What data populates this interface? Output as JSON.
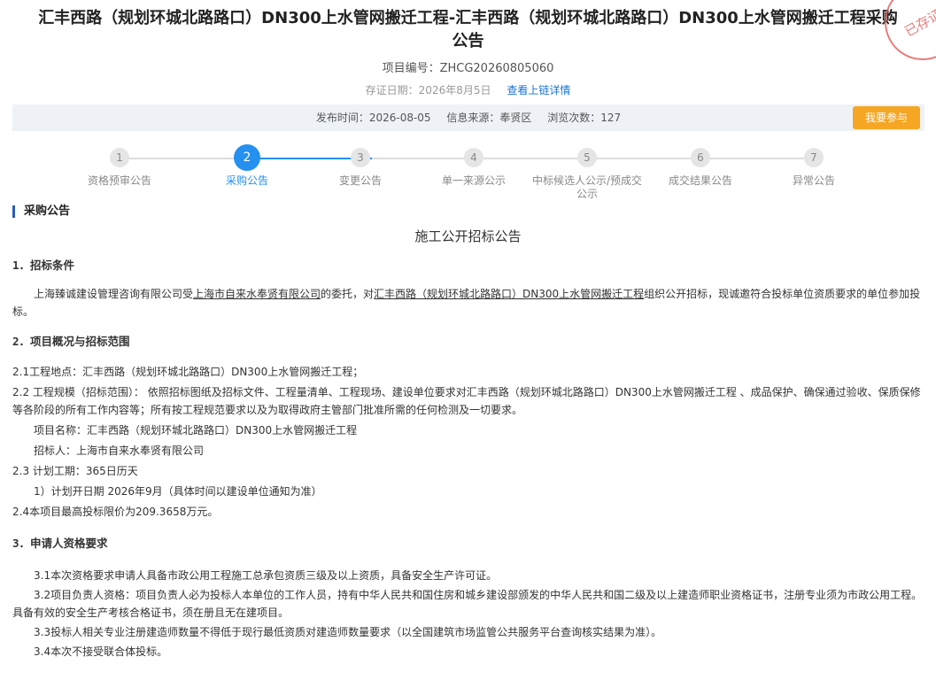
{
  "title": "汇丰西路（规划环城北路路口）DN300上水管网搬迁工程-汇丰西路（规划环城北路路口）DN300上水管网搬迁工程采购公告",
  "stamp_text": "已存证",
  "project_no": "项目编号：ZHCG20260805060",
  "deposit_date": "存证日期：2026年8月5日",
  "deposit_link": "查看上链详情",
  "info": {
    "publish_time": "发布时间：2026-08-05",
    "source": "信息来源：奉贤区",
    "views": "浏览次数：127",
    "join_button": "我要参与"
  },
  "steps": [
    {
      "num": "1",
      "label": "资格预审公告"
    },
    {
      "num": "2",
      "label": "采购公告"
    },
    {
      "num": "3",
      "label": "变更公告"
    },
    {
      "num": "4",
      "label": "单一来源公示"
    },
    {
      "num": "5",
      "label": "中标候选人公示/预成交公示"
    },
    {
      "num": "6",
      "label": "成交结果公告"
    },
    {
      "num": "7",
      "label": "异常公告"
    }
  ],
  "section_heading": "采购公告",
  "doc_title": "施工公开招标公告",
  "content": {
    "s1_head": "1．招标条件",
    "s1_p_a": "上海臻诚建设管理咨询有限公司受",
    "s1_p_b": "上海市自来水奉贤有限公司",
    "s1_p_c": "的委托，对",
    "s1_p_d": "汇丰西路（规划环城北路路口）DN300上水管网搬迁工程",
    "s1_p_e": "组织公开招标，现诚邀符合投标单位资质要求的单位参加投标。",
    "s2_head": "2．项目概况与招标范围",
    "s2_1": "2.1工程地点：汇丰西路（规划环城北路路口）DN300上水管网搬迁工程；",
    "s2_2": "2.2 工程规模（招标范围）： 依照招标图纸及招标文件、工程量清单、工程现场、建设单位要求对汇丰西路（规划环城北路路口）DN300上水管网搬迁工程 、成品保护、确保通过验收、保质保修等各阶段的所有工作内容等；所有按工程规范要求以及为取得政府主管部门批准所需的任何检测及一切要求。",
    "s2_name": "项目名称：汇丰西路（规划环城北路路口）DN300上水管网搬迁工程",
    "s2_bidder": "招标人：上海市自来水奉贤有限公司",
    "s2_3": "2.3 计划工期：365日历天",
    "s2_3_1": "1）计划开日期 2026年9月（具体时间以建设单位通知为准）",
    "s2_4": "2.4本项目最高投标限价为209.3658万元。",
    "s3_head": "3．申请人资格要求",
    "s3_1": "3.1本次资格要求申请人具备市政公用工程施工总承包资质三级及以上资质，具备安全生产许可证。",
    "s3_2": "3.2项目负责人资格：项目负责人必为投标人本单位的工作人员，持有中华人民共和国住房和城乡建设部颁发的中华人民共和国二级及以上建造师职业资格证书，注册专业须为市政公用工程。具备有效的安全生产考核合格证书，须在册且无在建项目。",
    "s3_3": "3.3投标人相关专业注册建造师数量不得低于现行最低资质对建造师数量要求（以全国建筑市场监管公共服务平台查询核实结果为准）。",
    "s3_4": "3.4本次不接受联合体投标。"
  },
  "colors": {
    "accent": "#2490f0",
    "join": "#f5a623",
    "link": "#1a73d9"
  }
}
